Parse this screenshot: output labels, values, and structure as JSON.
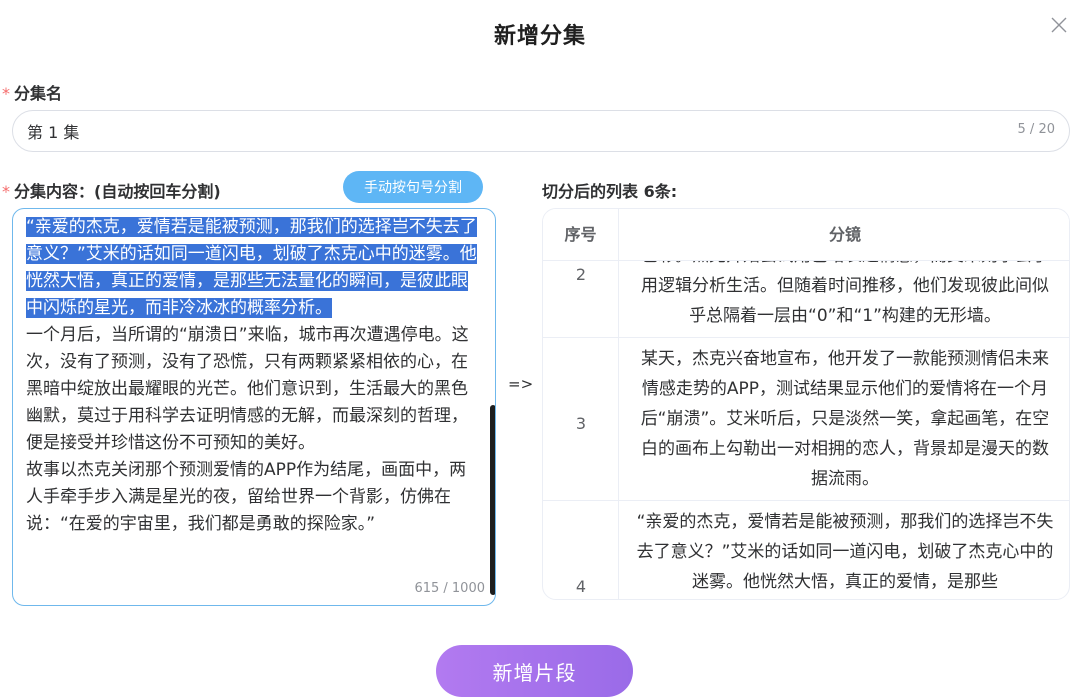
{
  "dialog": {
    "title": "新增分集"
  },
  "episode_name": {
    "label": "分集名",
    "required_mark": "*",
    "value": "第 1 集",
    "count": "5 / 20"
  },
  "content": {
    "label": "分集内容：(自动按回车分割)",
    "required_mark": "*",
    "split_button": "手动按句号分割",
    "selected_text": "“亲爱的杰克，爱情若是能被预测，那我们的选择岂不失去了意义？”艾米的话如同一道闪电，划破了杰克心中的迷雾。他恍然大悟，真正的爱情，是那些无法量化的瞬间，是彼此眼中闪烁的星光，而非冷冰冰的概率分析。",
    "rest_text_1": "一个月后，当所谓的“崩溃日”来临，城市再次遭遇停电。这次，没有了预测，没有了恐慌，只有两颗紧紧相依的心，在黑暗中绽放出最耀眼的光芒。他们意识到，生活最大的黑色幽默，莫过于用科学去证明情感的无解，而最深刻的哲理，便是接受并珍惜这份不可预知的美好。",
    "rest_text_2": "故事以杰克关闭那个预测爱情的APP作为结尾，画面中，两人手牵手步入满是星光的夜，留给世界一个背影，仿佛在说：“在爱的宇宙里，我们都是勇敢的探险家。”",
    "count": "615 / 1000"
  },
  "arrow": "=>",
  "split_list": {
    "label": "切分后的列表 6条:",
    "headers": {
      "seq": "序号",
      "segment": "分镜"
    },
    "rows": [
      {
        "seq": "2",
        "text": "色彩。杰克开始尝试用巴哈表达情感，而艾米则学会了用逻辑分析生活。但随着时间推移，他们发现彼此间似乎总隔着一层由“0”和“1”构建的无形墙。"
      },
      {
        "seq": "3",
        "text": "某天，杰克兴奋地宣布，他开发了一款能预测情侣未来情感走势的APP，测试结果显示他们的爱情将在一个月后“崩溃”。艾米听后，只是淡然一笑，拿起画笔，在空白的画布上勾勒出一对相拥的恋人，背景却是漫天的数据流雨。"
      },
      {
        "seq": "4",
        "text": "“亲爱的杰克，爱情若是能被预测，那我们的选择岂不失去了意义？”艾米的话如同一道闪电，划破了杰克心中的迷雾。他恍然大悟，真正的爱情，是那些"
      }
    ]
  },
  "footer": {
    "add_button": "新增片段"
  }
}
